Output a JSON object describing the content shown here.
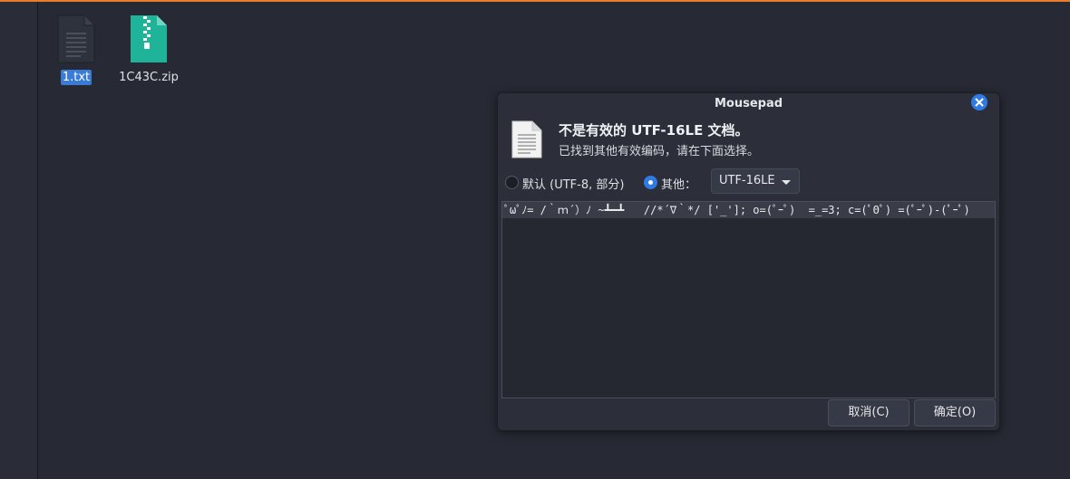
{
  "desktop": {
    "files": [
      {
        "name": "1.txt",
        "icon": "text-file-icon",
        "selected": true
      },
      {
        "name": "1C43C.zip",
        "icon": "zip-archive-icon",
        "selected": false
      }
    ]
  },
  "dialog": {
    "title": "Mousepad",
    "message_title": "不是有效的 UTF-16LE 文档。",
    "message_subtitle": "已找到其他有效编码，请在下面选择。",
    "encoding_options": {
      "default_label": "默认 (UTF-8, 部分)",
      "other_label": "其他：",
      "selected": "other"
    },
    "encoding_combo": {
      "value": "UTF-16LE"
    },
    "preview_text": "ﾟωﾟﾉ= /｀ｍ´）ﾉ ~┻━┻   //*´∇｀*/ ['_']; o=(ﾟｰﾟ)  =_=3; c=(ﾟΘﾟ) =(ﾟｰﾟ)-(ﾟｰﾟ)",
    "buttons": {
      "cancel": "取消(C)",
      "ok": "确定(O)"
    }
  },
  "colors": {
    "accent": "#2f7be6",
    "top_border": "#e87b2c",
    "background": "#272a34",
    "dialog_bg": "#2c2f39",
    "zip_icon": "#1fb39a"
  }
}
